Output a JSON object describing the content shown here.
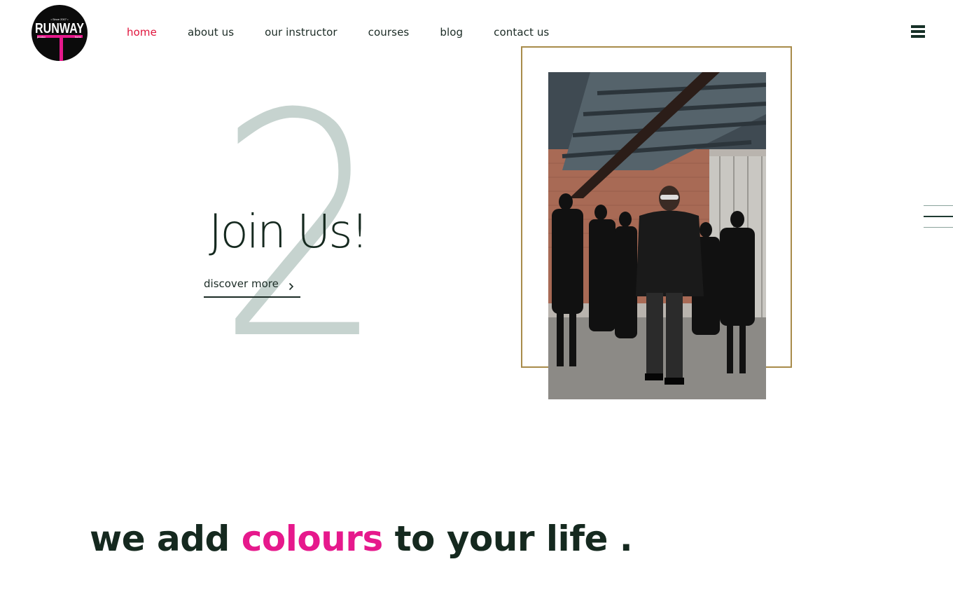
{
  "logo": {
    "brand_text": "RUNWAY",
    "sub_text_left": "produc",
    "sub_text_right": "tions",
    "since_text": "• Since 2007 •",
    "colors": {
      "background": "#0b0b0b",
      "accent": "#e6198c"
    }
  },
  "nav": {
    "items": [
      {
        "label": "home",
        "active": true
      },
      {
        "label": "about us",
        "active": false
      },
      {
        "label": "our instructor",
        "active": false
      },
      {
        "label": "courses",
        "active": false
      },
      {
        "label": "blog",
        "active": false
      },
      {
        "label": "contact us",
        "active": false
      }
    ],
    "menu_icon": "hamburger-icon"
  },
  "hero": {
    "slide_number": "2",
    "title": "Join Us!",
    "cta_label": "discover more",
    "cta_icon": "chevron-right-icon",
    "photo_alt_icon": "runway-photo"
  },
  "tagline": {
    "part1": "we add ",
    "highlight": "colours",
    "part2": " to your life ."
  },
  "colors": {
    "accent_pink": "#e6198c",
    "nav_active": "#e0143c",
    "text_dark": "#15291f",
    "frame_gold": "#a88b4a",
    "numeral_grey": "#c6d3cf"
  }
}
